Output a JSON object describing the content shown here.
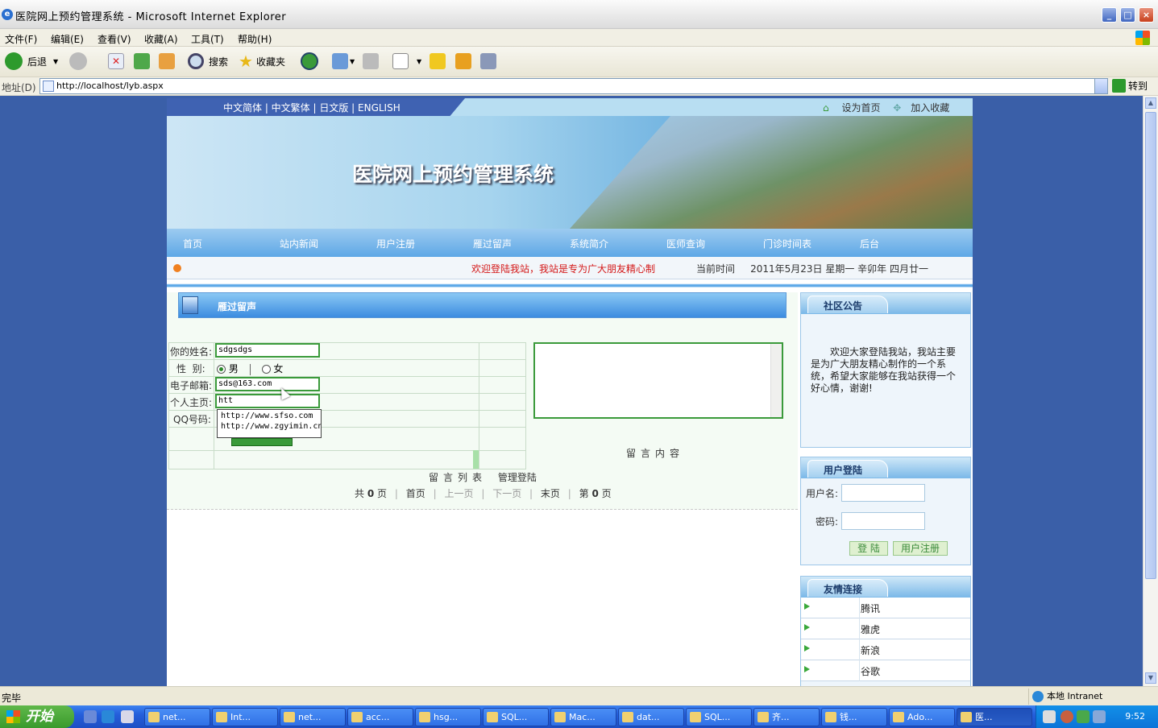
{
  "window": {
    "title": "医院网上预约管理系统 - Microsoft Internet Explorer"
  },
  "menu": [
    "文件(F)",
    "编辑(E)",
    "查看(V)",
    "收藏(A)",
    "工具(T)",
    "帮助(H)"
  ],
  "toolbar": {
    "back": "后退",
    "search": "搜索",
    "favorites": "收藏夹"
  },
  "address": {
    "label": "地址(D)",
    "url": "http://localhost/lyb.aspx",
    "go": "转到"
  },
  "site": {
    "langs": "中文简体 | 中文繁体 | 日文版 | ENGLISH",
    "set_home": "设为首页",
    "add_fav": "加入收藏",
    "title": "医院网上预约管理系统",
    "nav": [
      "首页",
      "站内新闻",
      "用户注册",
      "雁过留声",
      "系统简介",
      "医师查询",
      "门诊时间表",
      "后台"
    ],
    "marquee": "欢迎登陆我站，我站是专为广大朋友精心制",
    "current_time_label": "当前时间",
    "current_time": "2011年5月23日 星期一 辛卯年 四月廿一"
  },
  "guestbook": {
    "section_title": "雁过留声",
    "name_label": "你的姓名:",
    "name_value": "sdgsdgs",
    "gender_label": "性  别:",
    "gender_male": "男",
    "gender_female": "女",
    "email_label": "电子邮箱:",
    "email_value": "sds@163.com",
    "homepage_label": "个人主页:",
    "homepage_value": "htt",
    "qq_label": "QQ号码:",
    "autocomplete": [
      "http://www.sfso.com",
      "http://www.zgyimin.cn"
    ],
    "content_caption": "留言内容",
    "list_label": "留言列表",
    "admin_login": "管理登陆",
    "pager": {
      "total_prefix": "共",
      "total": "0",
      "total_suffix": "页",
      "first": "首页",
      "prev": "上一页",
      "next": "下一页",
      "last": "末页",
      "cur_prefix": "第",
      "cur": "0",
      "cur_suffix": "页"
    }
  },
  "sidebar": {
    "notice_title": "社区公告",
    "notice_text": "欢迎大家登陆我站，我站主要是为广大朋友精心制作的一个系统，希望大家能够在我站获得一个好心情，谢谢!",
    "login_title": "用户登陆",
    "username_label": "用户名:",
    "password_label": "密码:",
    "login_btn": "登 陆",
    "register_btn": "用户注册",
    "links_title": "友情连接",
    "links": [
      "腾讯",
      "雅虎",
      "新浪",
      "谷歌"
    ]
  },
  "status": {
    "left": "完毕",
    "zone": "本地 Intranet"
  },
  "taskbar": {
    "start": "开始",
    "tasks": [
      "net...",
      "Int...",
      "net...",
      "acc...",
      "hsg...",
      "SQL...",
      "Mac...",
      "dat...",
      "SQL...",
      "齐...",
      "钱...",
      "Ado...",
      "医..."
    ],
    "clock": "9:52"
  }
}
